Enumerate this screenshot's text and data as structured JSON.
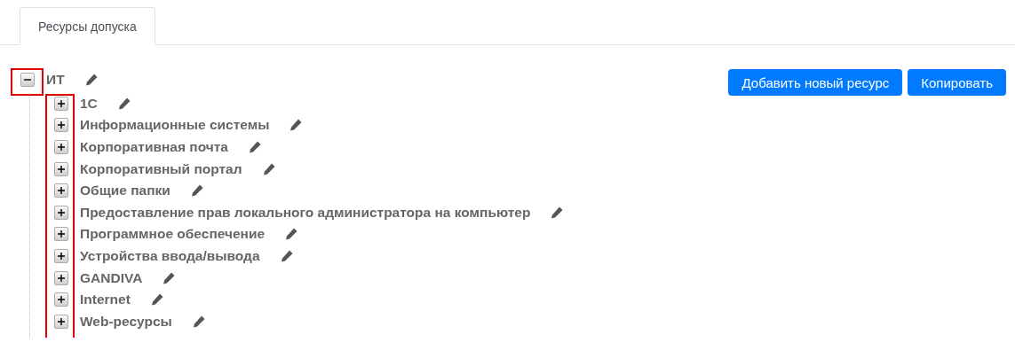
{
  "tabs": [
    {
      "label": "Ресурсы допуска",
      "selected": true
    }
  ],
  "buttons": [
    "Добавить новый ресурс",
    "Копировать"
  ],
  "tree": {
    "label": "ИТ",
    "expanded": true,
    "toggle_highlighted": true,
    "children_toggles_highlighted": true,
    "children": [
      {
        "label": "1С",
        "expanded": false
      },
      {
        "label": "Информационные системы",
        "expanded": false
      },
      {
        "label": "Корпоративная почта",
        "expanded": false
      },
      {
        "label": "Корпоративный портал",
        "expanded": false
      },
      {
        "label": "Общие папки",
        "expanded": false
      },
      {
        "label": "Предоставление прав локального администратора на компьютер",
        "expanded": false
      },
      {
        "label": "Программное обеспечение",
        "expanded": false
      },
      {
        "label": "Устройства ввода/вывода",
        "expanded": false
      },
      {
        "label": "GANDIVA",
        "expanded": false
      },
      {
        "label": "Internet",
        "expanded": false
      },
      {
        "label": "Web-ресурсы",
        "expanded": false
      }
    ]
  }
}
